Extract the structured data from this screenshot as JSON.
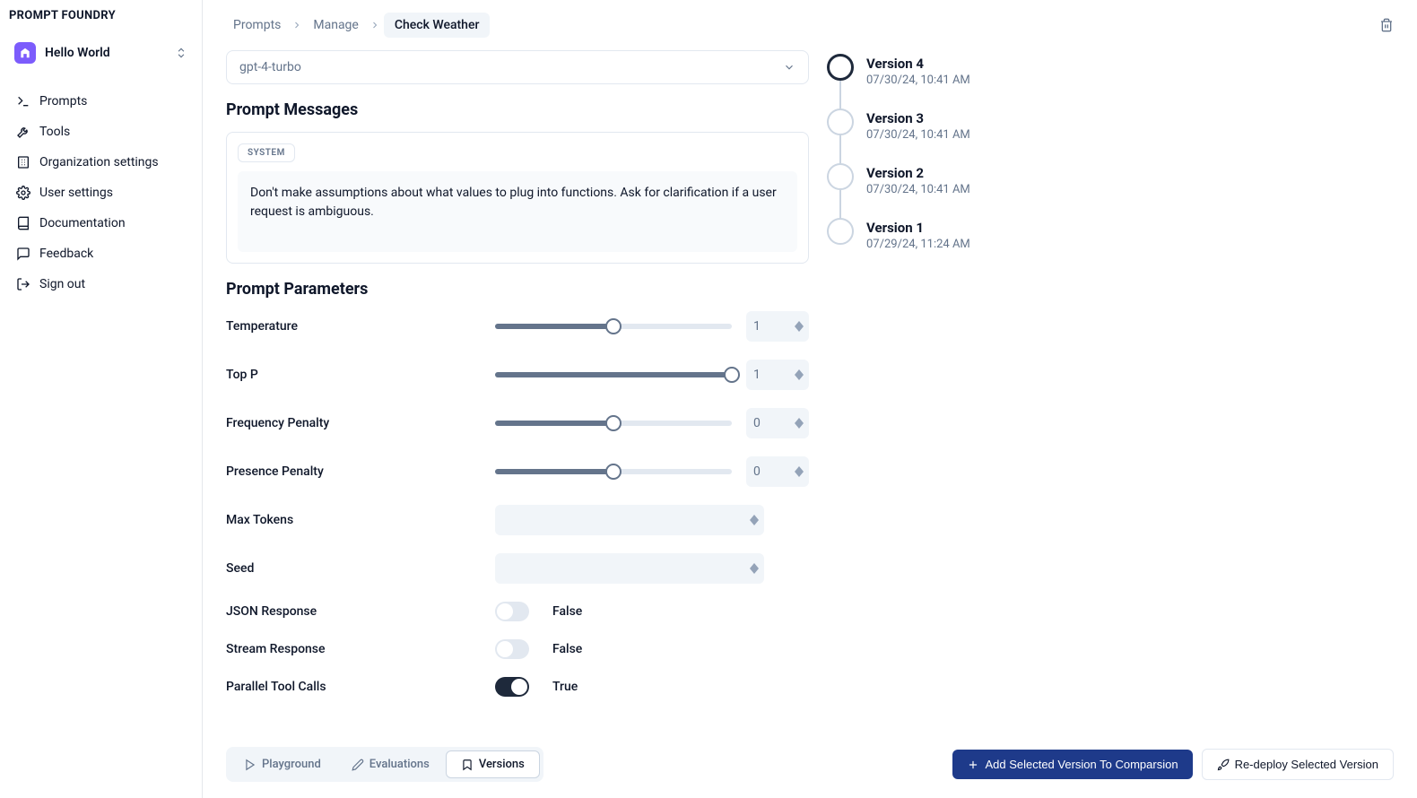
{
  "brand": "PROMPT FOUNDRY",
  "workspace": {
    "name": "Hello World"
  },
  "sidebar": {
    "items": [
      {
        "label": "Prompts",
        "icon": "terminal"
      },
      {
        "label": "Tools",
        "icon": "wrench"
      },
      {
        "label": "Organization settings",
        "icon": "building"
      },
      {
        "label": "User settings",
        "icon": "gear"
      },
      {
        "label": "Documentation",
        "icon": "book"
      },
      {
        "label": "Feedback",
        "icon": "chat"
      },
      {
        "label": "Sign out",
        "icon": "logout"
      }
    ]
  },
  "breadcrumb": {
    "root": "Prompts",
    "section": "Manage",
    "current": "Check Weather"
  },
  "model": {
    "selected": "gpt-4-turbo"
  },
  "sections": {
    "messages_title": "Prompt Messages",
    "parameters_title": "Prompt Parameters"
  },
  "message": {
    "role": "SYSTEM",
    "content": "Don't make assumptions about what values to plug into functions. Ask for clarification if a user request is ambiguous."
  },
  "params": {
    "temperature": {
      "label": "Temperature",
      "value": "1",
      "pct": 50
    },
    "top_p": {
      "label": "Top P",
      "value": "1",
      "pct": 100
    },
    "frequency_penalty": {
      "label": "Frequency Penalty",
      "value": "0",
      "pct": 50
    },
    "presence_penalty": {
      "label": "Presence Penalty",
      "value": "0",
      "pct": 50
    },
    "max_tokens": {
      "label": "Max Tokens",
      "value": ""
    },
    "seed": {
      "label": "Seed",
      "value": ""
    },
    "json_response": {
      "label": "JSON Response",
      "value": false,
      "text": "False"
    },
    "stream_response": {
      "label": "Stream Response",
      "value": false,
      "text": "False"
    },
    "parallel_tool_calls": {
      "label": "Parallel Tool Calls",
      "value": true,
      "text": "True"
    }
  },
  "versions": [
    {
      "title": "Version 4",
      "date": "07/30/24, 10:41 AM",
      "selected": true
    },
    {
      "title": "Version 3",
      "date": "07/30/24, 10:41 AM",
      "selected": false
    },
    {
      "title": "Version 2",
      "date": "07/30/24, 10:41 AM",
      "selected": false
    },
    {
      "title": "Version 1",
      "date": "07/29/24, 11:24 AM",
      "selected": false
    }
  ],
  "footer": {
    "tabs": [
      {
        "label": "Playground",
        "icon": "play"
      },
      {
        "label": "Evaluations",
        "icon": "pencil"
      },
      {
        "label": "Versions",
        "icon": "bookmark",
        "active": true
      }
    ],
    "add_comparison": "Add Selected Version To Comparsion",
    "redeploy": "Re-deploy Selected Version"
  }
}
